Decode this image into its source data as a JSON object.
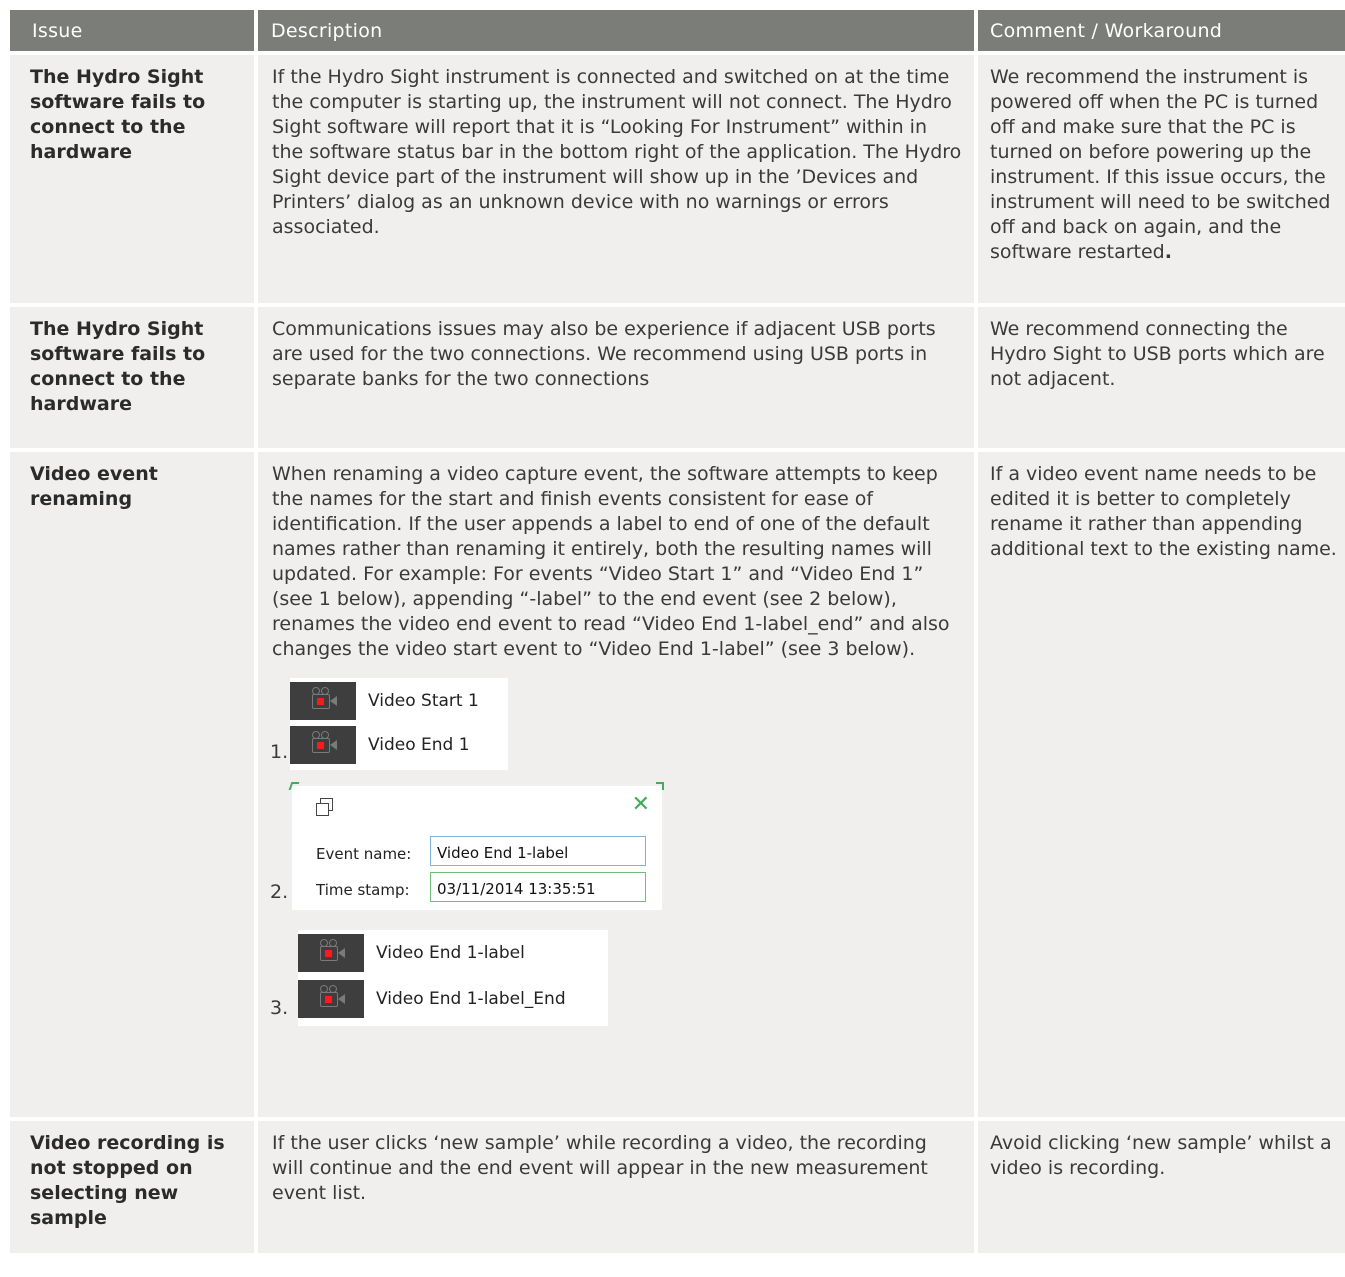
{
  "headers": {
    "issue": "Issue",
    "description": "Description",
    "comment": "Comment / Workaround"
  },
  "rows": [
    {
      "issue": "The Hydro Sight software fails to connect to the hardware",
      "description": "If the Hydro Sight instrument is connected and switched on at the time the computer is starting up, the instrument will not connect. The Hydro Sight software will report that it is “Looking For Instrument” within in the software status bar in the bottom right of the application. The Hydro Sight device part of the instrument will show up in the ’Devices and Printers’ dialog as an unknown device with no warnings or errors associated.",
      "comment": "We recommend the instrument is powered off when the PC is turned off and make sure that the PC is turned on before powering up the instrument.  If this issue occurs, the instrument will need to be switched off and back on again, and the software restarted",
      "comment_end": "."
    },
    {
      "issue": "The Hydro Sight software fails to connect to the hardware",
      "description": "Communications issues may also be experience if adjacent USB ports are used for the two connections. We recommend using USB ports in separate banks for the two connections",
      "comment": "We recommend connecting the Hydro Sight to USB ports which are not adjacent."
    },
    {
      "issue": "Video event renaming",
      "description": "When renaming a video capture event, the software attempts to keep the names for the start and finish events consistent for ease of identification.  If the user appends a label to end of one of the default names rather than renaming it entirely, both the resulting names will updated. For example: For events “Video Start 1” and “Video End 1” (see 1 below), appending “-label” to the end event (see 2 below), renames the video end event to read “Video End 1-label_end” and also changes the video start event to “Video End 1-label” (see 3 below).",
      "comment": "If a video event name needs to be edited it is better to completely rename it rather than appending additional text to the existing name.",
      "figures": {
        "fig1": {
          "num": "1.",
          "items": [
            "Video Start 1",
            "Video End 1"
          ]
        },
        "fig2": {
          "num": "2.",
          "event_label": "Event name:",
          "event_value": "Video End 1-label",
          "time_label": "Time stamp:",
          "time_value": "03/11/2014 13:35:51",
          "close": "✕"
        },
        "fig3": {
          "num": "3.",
          "items": [
            "Video End 1-label",
            "Video End 1-label_End"
          ]
        }
      }
    },
    {
      "issue": "Video recording is not stopped on selecting new sample",
      "description": "If the user clicks ‘new sample’ while recording a video, the recording will continue and the end event will appear in the new measurement event list.",
      "comment": "Avoid clicking ‘new sample’ whilst a video is recording."
    }
  ]
}
